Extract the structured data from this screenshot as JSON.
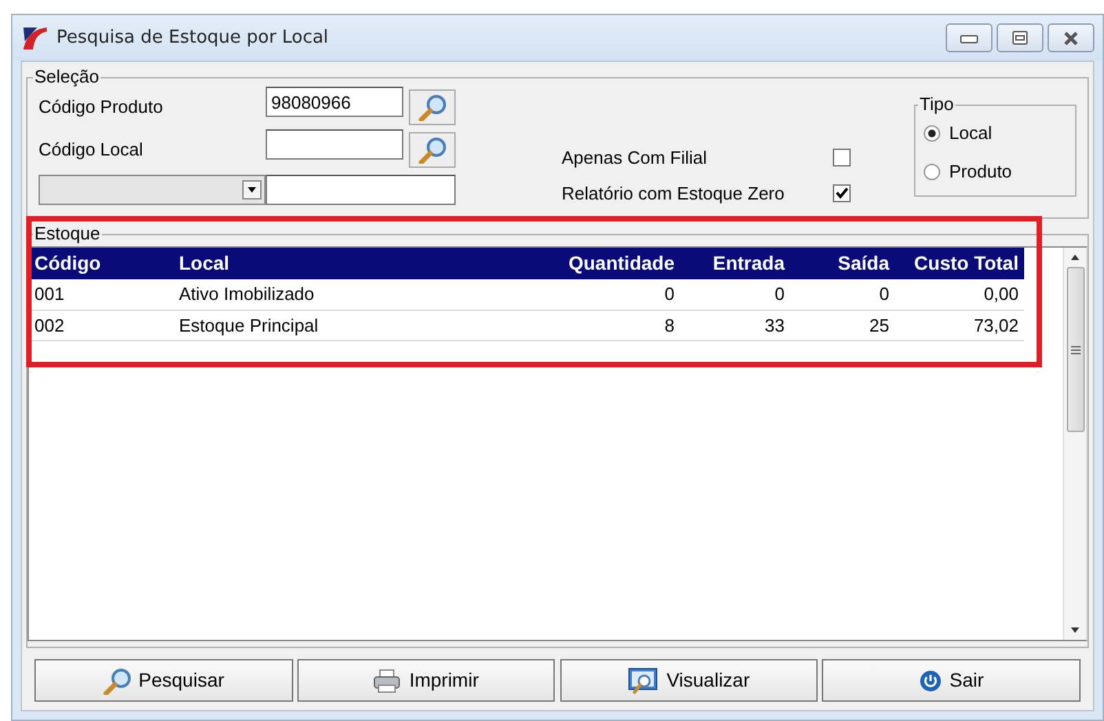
{
  "window": {
    "title": "Pesquisa de Estoque por Local"
  },
  "selecao": {
    "title": "Seleção",
    "fields": [
      {
        "label": "Código Produto",
        "value": "98080966"
      },
      {
        "label": "Código Local"
      }
    ],
    "checkboxes": [
      {
        "label": "Apenas Com Filial",
        "checked": false
      },
      {
        "label": "Relatório com Estoque Zero",
        "checked": true
      }
    ],
    "tipo": {
      "title": "Tipo",
      "options": [
        {
          "label": "Local",
          "selected": true
        },
        {
          "label": "Produto",
          "selected": false
        }
      ]
    }
  },
  "estoque": {
    "title": "Estoque",
    "columns": [
      {
        "label": "Código"
      },
      {
        "label": "Local"
      },
      {
        "label": "Quantidade"
      },
      {
        "label": "Entrada"
      },
      {
        "label": "Saída"
      },
      {
        "label": "Custo Total"
      }
    ],
    "rows": [
      [
        "001",
        "Ativo Imobilizado",
        "0",
        "0",
        "0",
        "0,00"
      ],
      [
        "002",
        "Estoque Principal",
        "8",
        "33",
        "25",
        "73,02"
      ]
    ]
  },
  "buttons": [
    {
      "label": "Pesquisar"
    },
    {
      "label": "Imprimir"
    },
    {
      "label": "Visualizar"
    },
    {
      "label": "Sair"
    }
  ]
}
